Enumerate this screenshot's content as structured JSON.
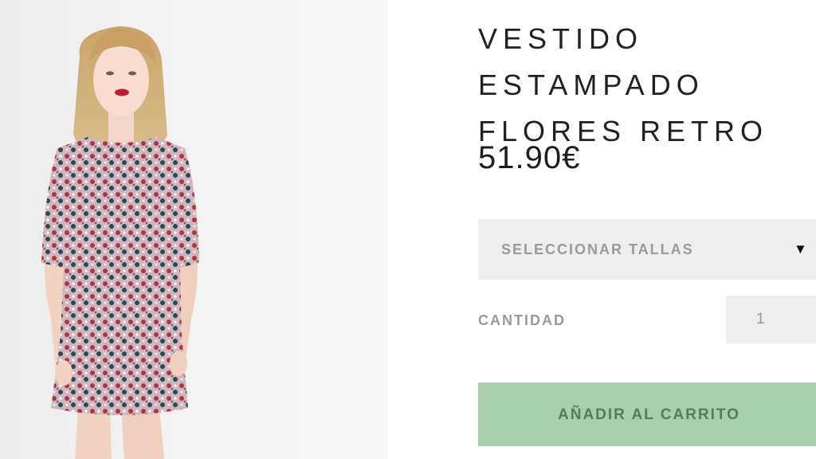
{
  "product": {
    "title": "VESTIDO ESTAMPADO\nFLORES RETRO",
    "price": "51.90€",
    "image_icon": "product-photo"
  },
  "size_select": {
    "label": "SELECCIONAR TALLAS",
    "arrow_icon": "caret-down-icon",
    "arrow_glyph": "▼"
  },
  "quantity": {
    "label": "CANTIDAD",
    "value": "1"
  },
  "cart_button": {
    "label": "AÑADIR AL CARRITO"
  },
  "colors": {
    "button_bg": "#a8ceab",
    "field_bg": "#eeeeee",
    "label_grey": "#9a9a9a"
  }
}
